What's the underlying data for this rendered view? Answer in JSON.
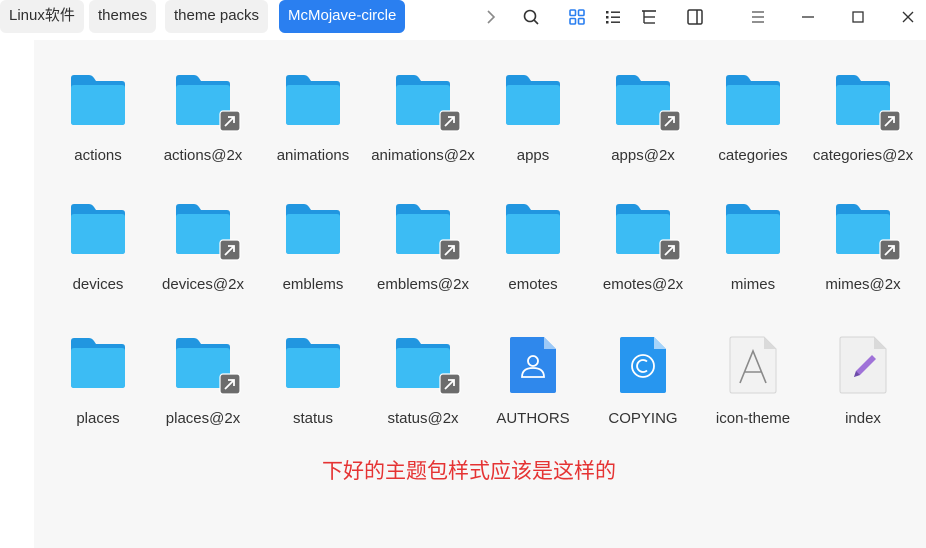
{
  "breadcrumbs": [
    {
      "label": "Linux软件",
      "active": false
    },
    {
      "label": "themes",
      "active": false
    },
    {
      "label": "theme packs",
      "active": false
    },
    {
      "label": "McMojave-circle",
      "active": true
    }
  ],
  "toolbar_icons": [
    "chevron-right-icon",
    "search-icon",
    "icon-view-icon",
    "list-view-icon",
    "tree-view-icon",
    "sidebar-toggle-icon",
    "menu-icon",
    "minimize-icon",
    "maximize-icon",
    "close-icon"
  ],
  "items": [
    {
      "label": "actions",
      "kind": "folder"
    },
    {
      "label": "actions@2x",
      "kind": "folder-link"
    },
    {
      "label": "animations",
      "kind": "folder"
    },
    {
      "label": "animations@2x",
      "kind": "folder-link"
    },
    {
      "label": "apps",
      "kind": "folder"
    },
    {
      "label": "apps@2x",
      "kind": "folder-link"
    },
    {
      "label": "categories",
      "kind": "folder"
    },
    {
      "label": "categories@2x",
      "kind": "folder-link"
    },
    {
      "label": "devices",
      "kind": "folder"
    },
    {
      "label": "devices@2x",
      "kind": "folder-link"
    },
    {
      "label": "emblems",
      "kind": "folder"
    },
    {
      "label": "emblems@2x",
      "kind": "folder-link"
    },
    {
      "label": "emotes",
      "kind": "folder"
    },
    {
      "label": "emotes@2x",
      "kind": "folder-link"
    },
    {
      "label": "mimes",
      "kind": "folder"
    },
    {
      "label": "mimes@2x",
      "kind": "folder-link"
    },
    {
      "label": "places",
      "kind": "folder"
    },
    {
      "label": "places@2x",
      "kind": "folder-link"
    },
    {
      "label": "status",
      "kind": "folder"
    },
    {
      "label": "status@2x",
      "kind": "folder-link"
    },
    {
      "label": "AUTHORS",
      "kind": "authors-file"
    },
    {
      "label": "COPYING",
      "kind": "copying-file"
    },
    {
      "label": "icon-theme",
      "kind": "font-file"
    },
    {
      "label": "index",
      "kind": "text-file"
    }
  ],
  "note": "下好的主题包样式应该是这样的",
  "colors": {
    "accent": "#2a7ff0",
    "folder_top": "#2196e0",
    "folder_front": "#3cbcf4",
    "note": "#e53333"
  }
}
